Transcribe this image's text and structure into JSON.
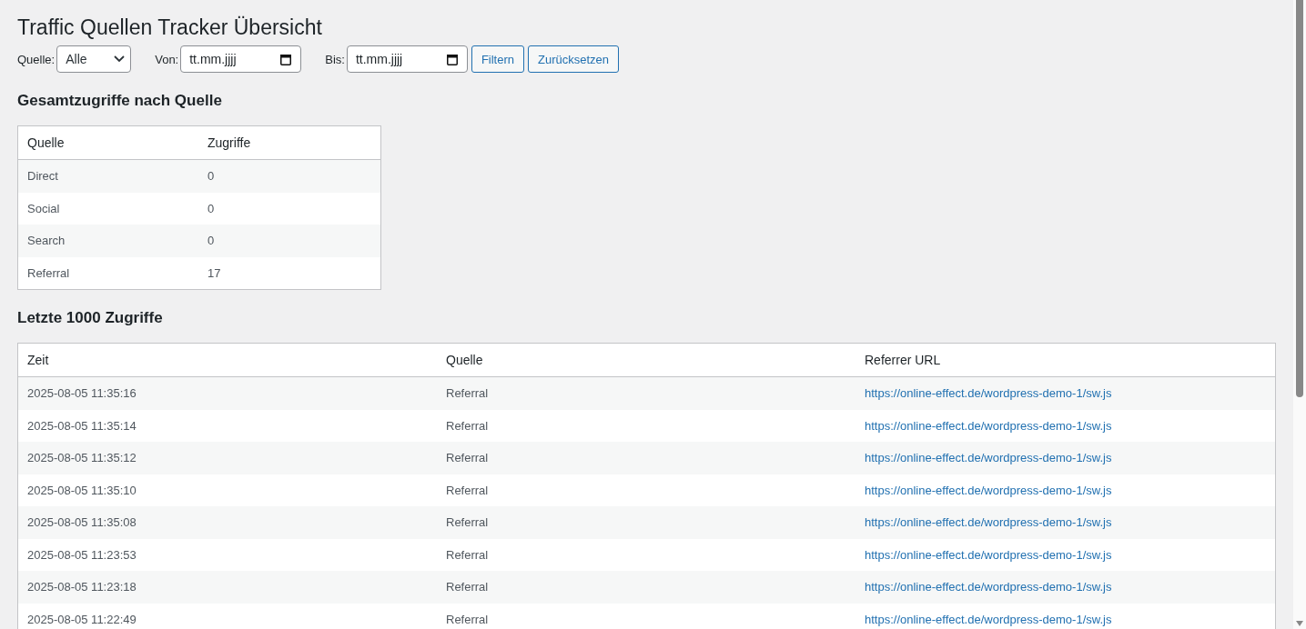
{
  "page": {
    "title": "Traffic Quellen Tracker Übersicht"
  },
  "filters": {
    "source_label": "Quelle:",
    "source_value": "Alle",
    "from_label": "Von:",
    "from_placeholder": "tt.mm.jjjj",
    "to_label": "Bis:",
    "to_placeholder": "tt.mm.jjjj",
    "buttons": [
      "Filtern",
      "Zurücksetzen"
    ]
  },
  "totals": {
    "heading": "Gesamtzugriffe nach Quelle",
    "columns": [
      "Quelle",
      "Zugriffe"
    ],
    "rows": [
      [
        "Direct",
        "0"
      ],
      [
        "Social",
        "0"
      ],
      [
        "Search",
        "0"
      ],
      [
        "Referral",
        "17"
      ]
    ]
  },
  "recent": {
    "heading": "Letzte 1000 Zugriffe",
    "columns": [
      "Zeit",
      "Quelle",
      "Referrer URL"
    ],
    "rows": [
      [
        "2025-08-05 11:35:16",
        "Referral",
        "https://online-effect.de/wordpress-demo-1/sw.js"
      ],
      [
        "2025-08-05 11:35:14",
        "Referral",
        "https://online-effect.de/wordpress-demo-1/sw.js"
      ],
      [
        "2025-08-05 11:35:12",
        "Referral",
        "https://online-effect.de/wordpress-demo-1/sw.js"
      ],
      [
        "2025-08-05 11:35:10",
        "Referral",
        "https://online-effect.de/wordpress-demo-1/sw.js"
      ],
      [
        "2025-08-05 11:35:08",
        "Referral",
        "https://online-effect.de/wordpress-demo-1/sw.js"
      ],
      [
        "2025-08-05 11:23:53",
        "Referral",
        "https://online-effect.de/wordpress-demo-1/sw.js"
      ],
      [
        "2025-08-05 11:23:18",
        "Referral",
        "https://online-effect.de/wordpress-demo-1/sw.js"
      ],
      [
        "2025-08-05 11:22:49",
        "Referral",
        "https://online-effect.de/wordpress-demo-1/sw.js"
      ]
    ]
  }
}
